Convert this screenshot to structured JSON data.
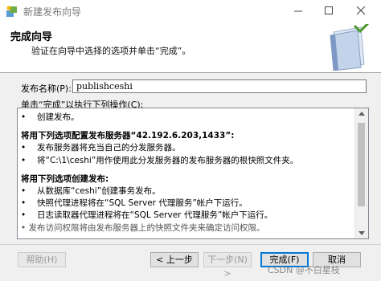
{
  "window": {
    "title": "新建发布向导",
    "icons": {
      "app": "wizard-app-icon",
      "min": "minimize-icon",
      "max": "maximize-icon",
      "close": "close-icon"
    }
  },
  "header": {
    "title": "完成向导",
    "subtitle": "验证在向导中选择的选项并单击“完成”。",
    "art_icon": "book-wizard-icon"
  },
  "form": {
    "name_label": "发布名称(P):",
    "name_value": "publishceshi",
    "actions_label": "单击“完成”以执行下列操作(C):"
  },
  "actions": [
    {
      "type": "bullet",
      "text": "创建发布。"
    },
    {
      "type": "gap"
    },
    {
      "type": "heading",
      "text": "将用下列选项配置发布服务器“42.192.6.203,1433”:"
    },
    {
      "type": "bullet",
      "text": "发布服务器将充当自己的分发服务器。"
    },
    {
      "type": "bullet",
      "text": "将“C:\\1\\ceshi”用作使用此分发服务器的发布服务器的根快照文件夹。"
    },
    {
      "type": "gap"
    },
    {
      "type": "heading",
      "text": "将用下列选项创建发布:"
    },
    {
      "type": "bullet",
      "text": "从数据库“ceshi”创建事务发布。"
    },
    {
      "type": "bullet",
      "text": "快照代理进程将在“SQL Server 代理服务”帐户下运行。"
    },
    {
      "type": "bullet",
      "text": "日志读取器代理进程将在“SQL Server 代理服务”帐户下运行。"
    },
    {
      "type": "cut",
      "text": "• 发布访问权限将由发布服务器上的快照文件夹来确定访问权限。"
    }
  ],
  "buttons": {
    "help": "帮助(H)",
    "back": "< 上一步",
    "next": "下一步(N) >",
    "finish": "完成(F)",
    "cancel": "取消"
  },
  "watermark": "CSDN @不白星枝",
  "colors": {
    "accent": "#0078d7",
    "disabled_text": "#9a9a9a"
  }
}
